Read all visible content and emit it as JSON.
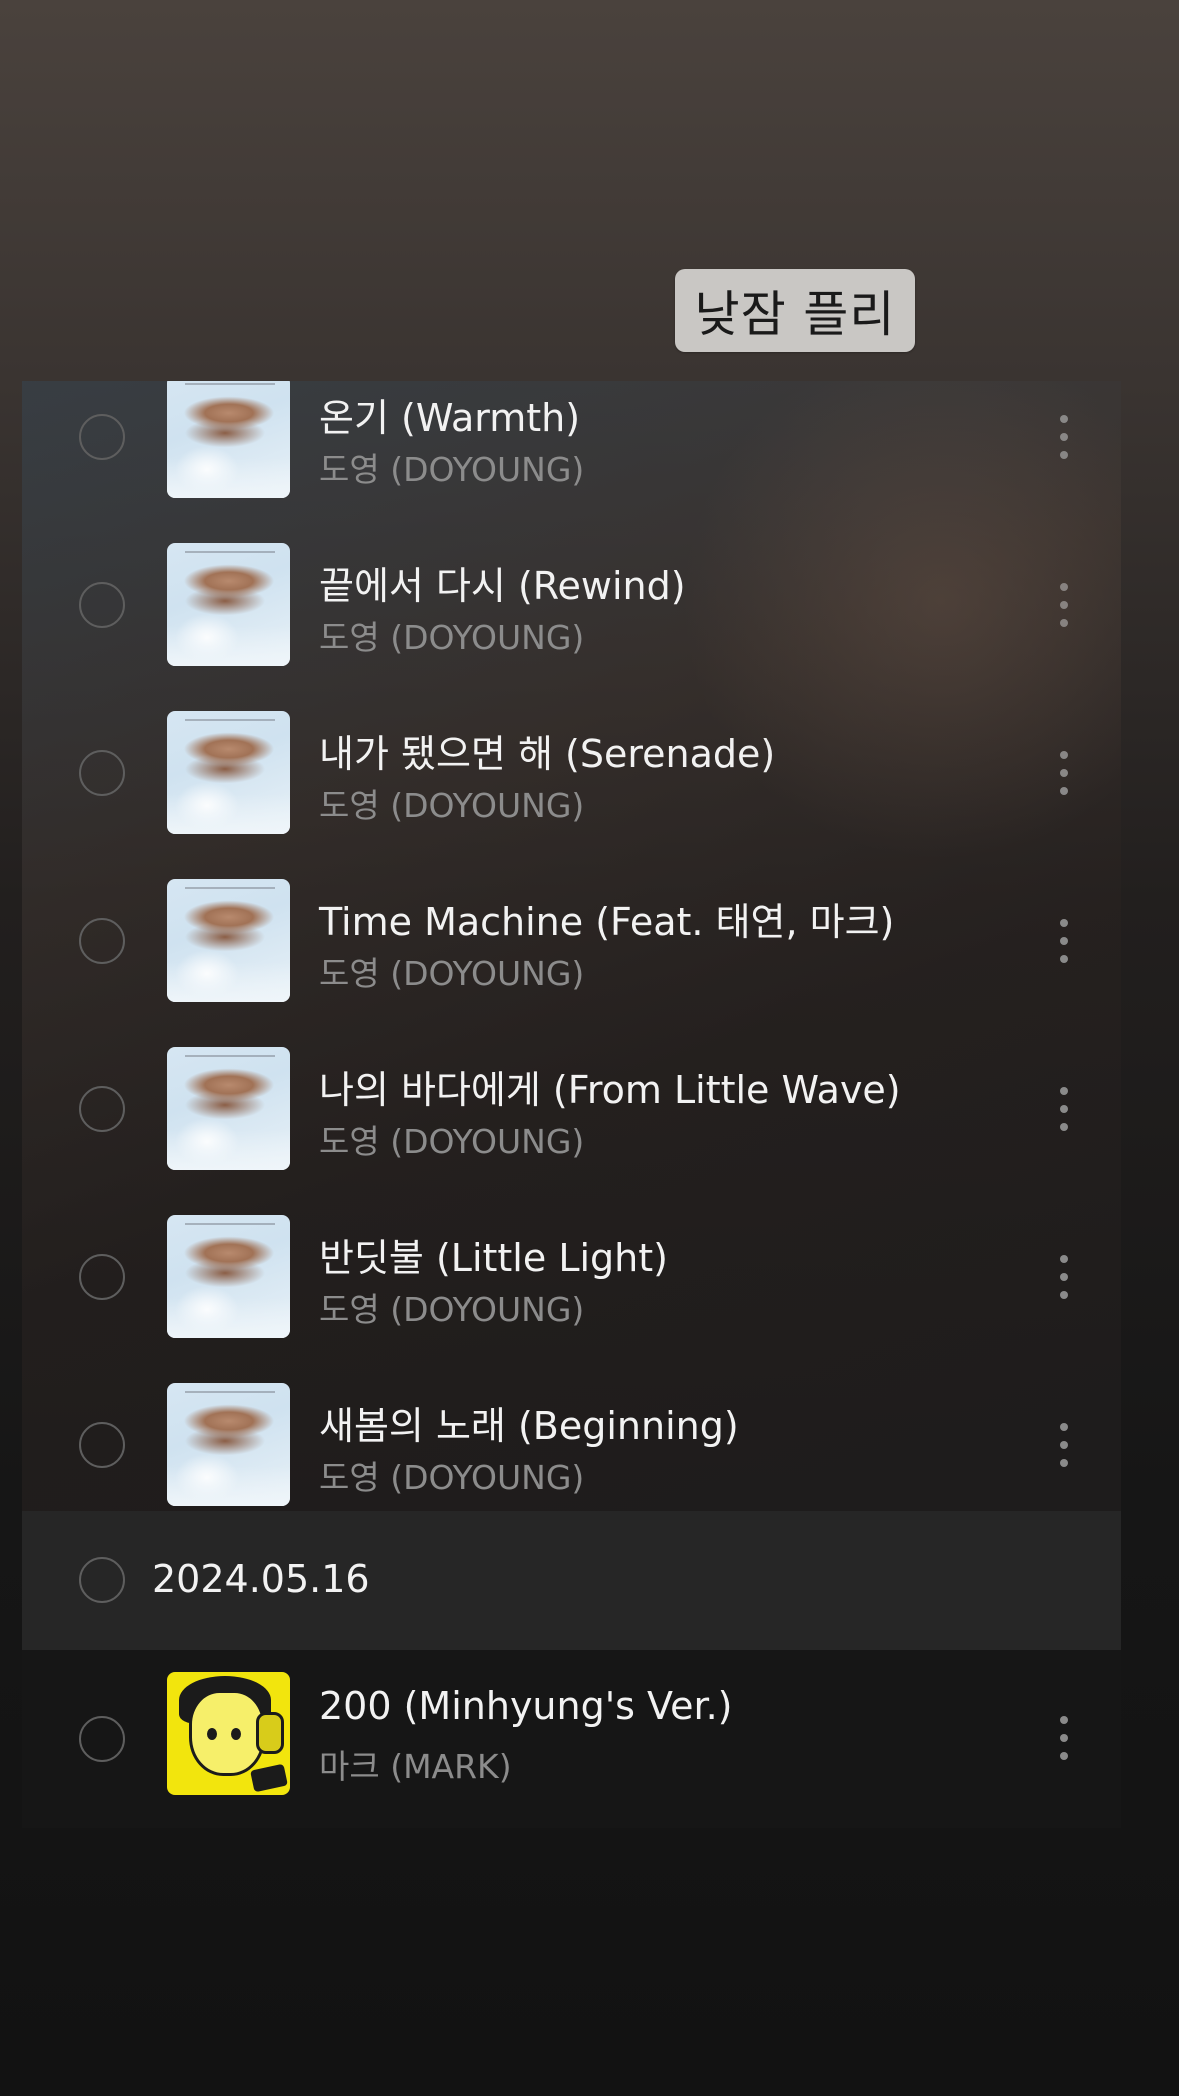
{
  "sticker": {
    "text": "낮잠 플리"
  },
  "tracks": [
    {
      "title": "온기 (Warmth)",
      "artist": "도영 (DOYOUNG)"
    },
    {
      "title": "끝에서 다시 (Rewind)",
      "artist": "도영 (DOYOUNG)"
    },
    {
      "title": "내가 됐으면 해 (Serenade)",
      "artist": "도영 (DOYOUNG)"
    },
    {
      "title": "Time Machine (Feat. 태연, 마크)",
      "artist": "도영 (DOYOUNG)"
    },
    {
      "title": "나의 바다에게 (From Little Wave)",
      "artist": "도영 (DOYOUNG)"
    },
    {
      "title": "반딧불 (Little Light)",
      "artist": "도영 (DOYOUNG)"
    },
    {
      "title": "새봄의 노래 (Beginning)",
      "artist": "도영 (DOYOUNG)"
    }
  ],
  "date_group": {
    "date": "2024.05.16"
  },
  "last_track": {
    "title": "200 (Minhyung's Ver.)",
    "artist": "마크 (MARK)"
  },
  "colors": {
    "sticker_bg": "#c9c7c4",
    "title_text": "#f2f2f2",
    "artist_text": "#8c8c8c",
    "album_mark": "#f2e50d"
  },
  "icons": {
    "select": "radio-circle-icon",
    "more": "more-vertical-icon"
  }
}
